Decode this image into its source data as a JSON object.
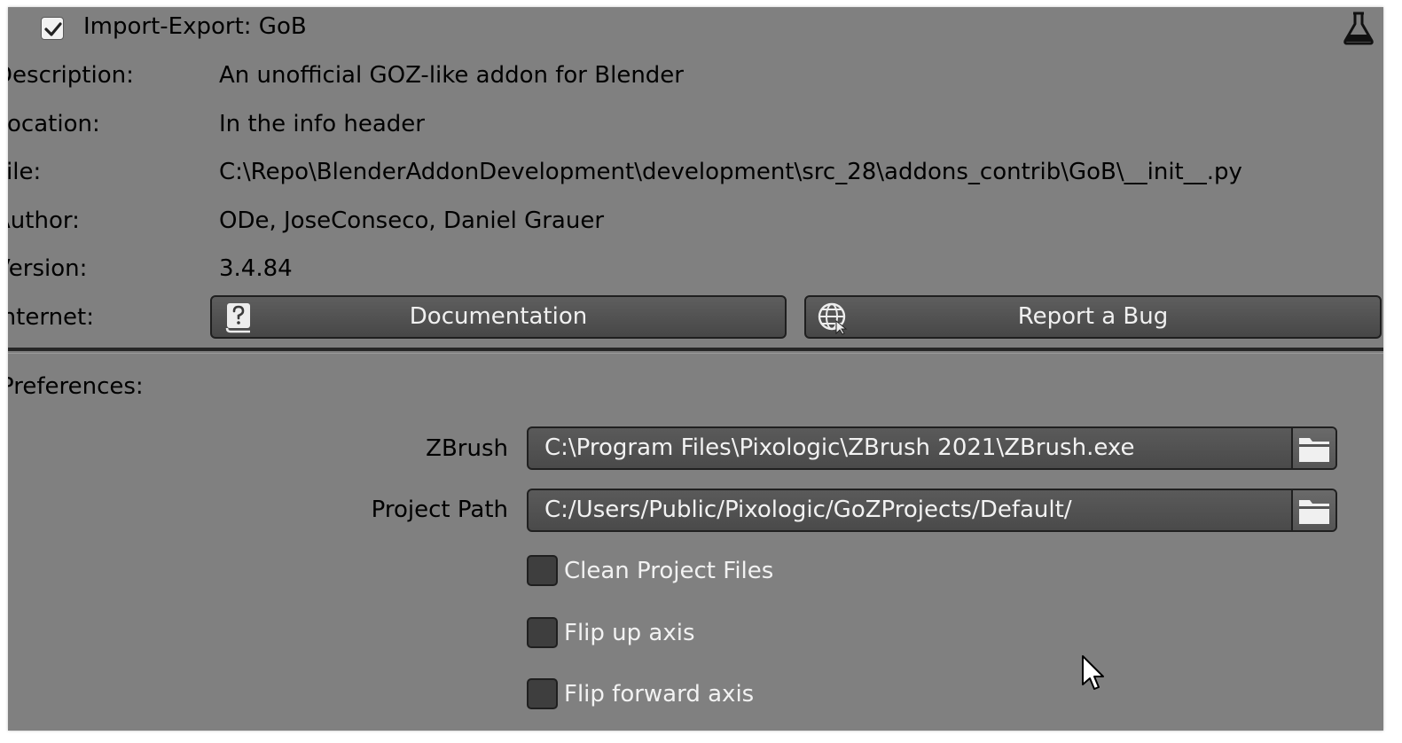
{
  "header": {
    "collapse_arrow": "▾",
    "enabled": true,
    "title": "Import-Export: GoB",
    "flask_icon": "flask-icon"
  },
  "info": {
    "description_label": "Description:",
    "description": "An unofficial GOZ-like addon for Blender",
    "location_label": "Location:",
    "location": "In the info header",
    "file_label": "File:",
    "file": "C:\\Repo\\BlenderAddonDevelopment\\development\\src_28\\addons_contrib\\GoB\\__init__.py",
    "author_label": "Author:",
    "author": "ODe, JoseConseco, Daniel Grauer",
    "version_label": "Version:",
    "version": "3.4.84",
    "internet_label": "Internet:"
  },
  "buttons": {
    "documentation": "Documentation",
    "report_bug": "Report a Bug"
  },
  "preferences": {
    "title": "Preferences:",
    "zbrush_label": "ZBrush",
    "zbrush_path": "C:\\Program Files\\Pixologic\\ZBrush 2021\\ZBrush.exe",
    "project_label": "Project Path",
    "project_path": "C:/Users/Public/Pixologic/GoZProjects/Default/",
    "checkboxes": [
      {
        "label": "Clean Project Files",
        "checked": false
      },
      {
        "label": "Flip up axis",
        "checked": false
      },
      {
        "label": "Flip forward axis",
        "checked": false
      }
    ]
  },
  "colors": {
    "panel_bg": "#808080",
    "button_bg": "#4f4f4f",
    "field_bg": "#525252"
  }
}
